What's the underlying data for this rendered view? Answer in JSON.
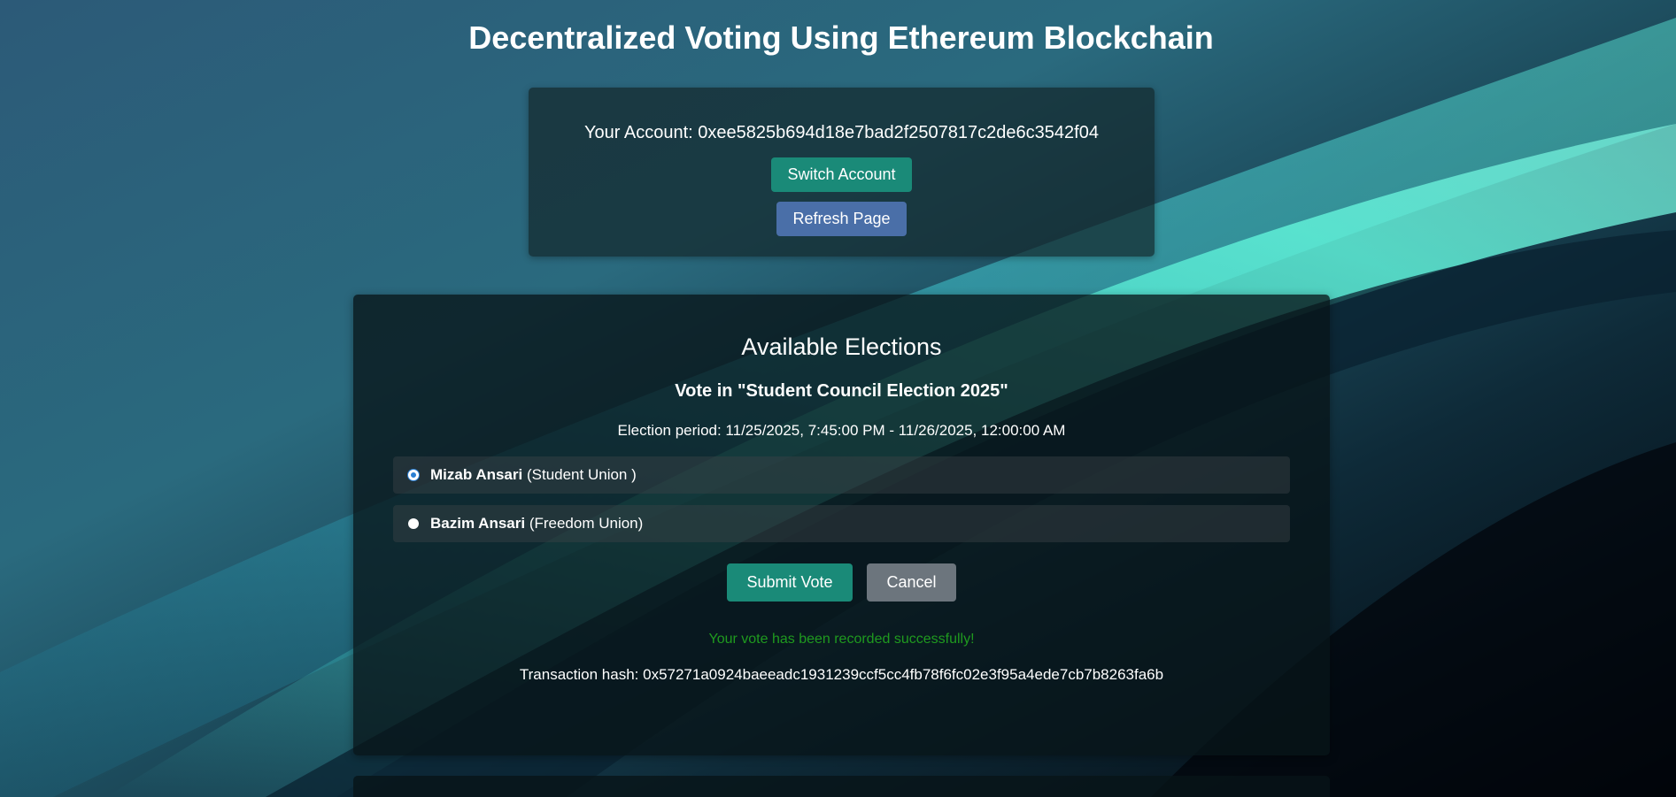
{
  "page": {
    "title": "Decentralized Voting Using Ethereum Blockchain"
  },
  "account": {
    "label": "Your Account: 0xee5825b694d18e7bad2f2507817c2de6c3542f04",
    "switch_label": "Switch Account",
    "refresh_label": "Refresh Page"
  },
  "elections": {
    "heading": "Available Elections",
    "vote_heading": "Vote in \"Student Council Election 2025\"",
    "period": "Election period: 11/25/2025, 7:45:00 PM - 11/26/2025, 12:00:00 AM",
    "candidates": [
      {
        "name": "Mizab Ansari",
        "party": "(Student Union )",
        "selected": true
      },
      {
        "name": "Bazim Ansari",
        "party": "(Freedom Union)",
        "selected": false
      }
    ],
    "submit_label": "Submit Vote",
    "cancel_label": "Cancel",
    "success_message": "Your vote has been recorded successfully!",
    "tx_hash": "Transaction hash: 0x57271a0924baeeadc1931239ccf5cc4fb78f6fc02e3f95a4ede7cb7b8263fa6b"
  },
  "colors": {
    "primary_button": "#1a8a78",
    "info_button": "#4a6fa8",
    "secondary_button": "#6c757d",
    "success_text": "#1f9a1f"
  }
}
